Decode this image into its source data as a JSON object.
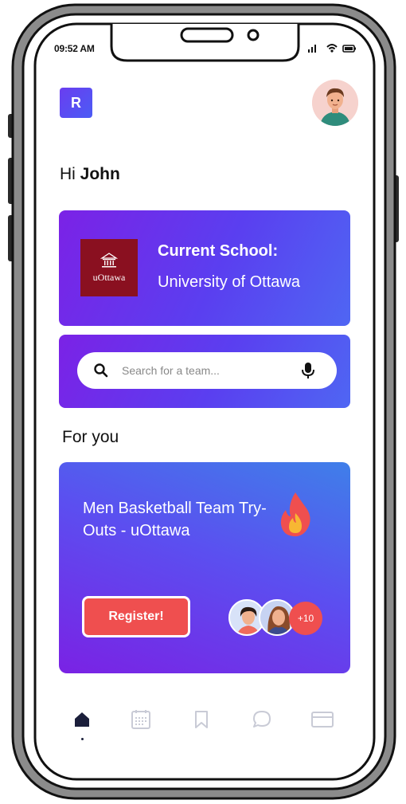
{
  "status_bar": {
    "time": "09:52 AM"
  },
  "app": {
    "logo_letter": "R"
  },
  "greeting": {
    "prefix": "Hi ",
    "name": "John"
  },
  "school_card": {
    "logo_text": "uOttawa",
    "label": "Current School:",
    "value": "University of Ottawa"
  },
  "search": {
    "placeholder": "Search for a team..."
  },
  "section": {
    "title": "For you"
  },
  "event_card": {
    "title": "Men Basketball Team Try-Outs - uOttawa",
    "register_label": "Register!",
    "more_count": "+10"
  },
  "bottom_nav": {
    "items": [
      {
        "icon": "home-icon",
        "active": true
      },
      {
        "icon": "calendar-icon",
        "active": false
      },
      {
        "icon": "bookmark-icon",
        "active": false
      },
      {
        "icon": "chat-icon",
        "active": false
      },
      {
        "icon": "card-icon",
        "active": false
      }
    ]
  },
  "colors": {
    "accent_purple": "#7b22e6",
    "accent_blue": "#4f66f3",
    "register_red": "#ef4f4f",
    "school_maroon": "#8a1020",
    "nav_active": "#1b1f3b",
    "nav_inactive": "#c9cbd6"
  }
}
